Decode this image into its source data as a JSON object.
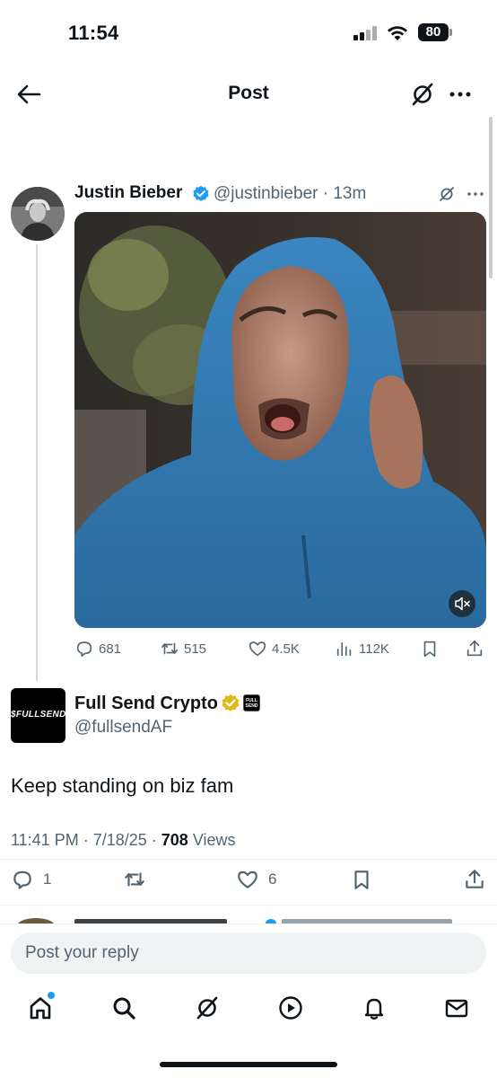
{
  "status_bar": {
    "time": "11:54",
    "battery": "80"
  },
  "header": {
    "title": "Post"
  },
  "tweet1": {
    "name": "Justin Bieber",
    "handle": "@justinbieber",
    "time": "13m",
    "actions": {
      "replies": "681",
      "reposts": "515",
      "likes": "4.5K",
      "views": "112K"
    }
  },
  "tweet2": {
    "name": "Full Send Crypto",
    "handle": "@fullsendAF",
    "avatar_text": "$FULLSEND",
    "affiliate_badge": "FULL SEND",
    "text": "Keep standing on biz fam",
    "time": "11:41 PM",
    "date": "7/18/25",
    "views_count": "708",
    "views_label": "Views",
    "actions": {
      "replies": "1",
      "likes": "6"
    }
  },
  "reply": {
    "placeholder": "Post your reply"
  },
  "tabs": [
    "home",
    "search",
    "grok",
    "video",
    "notifications",
    "messages"
  ],
  "colors": {
    "accent": "#1d9bf0",
    "verified_gold": "#e2b719",
    "muted": "#536471"
  }
}
